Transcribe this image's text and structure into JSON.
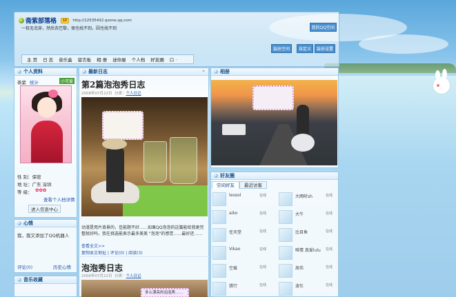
{
  "header": {
    "title": "斋紫部落格",
    "vip": "LV",
    "url": "http://12535432.qzone.qq.com",
    "motto": "一枝无北穿，然后去巴黎，保也找不到，因也找不到",
    "manage_button": "我的QQ空间",
    "nav": [
      "主 页",
      "日 志",
      "音乐盒",
      "留言板",
      "相 册",
      "迷你屋",
      "个人档",
      "好友圈",
      "口 ·"
    ],
    "top_buttons": [
      "装扮空间",
      "自定义",
      "装扮设置"
    ]
  },
  "profile": {
    "title": "个人资料",
    "name_label": "斋紫",
    "stats": "统计",
    "more": "小可爱",
    "gender_row": "性 别：保密",
    "location_row": "地 址：广东 深圳",
    "level_row": "等 级：",
    "view_profile": "查看个人档详情",
    "enter_center": "进入信息中心"
  },
  "mood": {
    "title": "心情",
    "text": "我，我又添加了QQ机器人",
    "comment": "评论(0)",
    "history": "历史心情"
  },
  "music": {
    "title": "音乐收藏"
  },
  "blog": {
    "title": "最新日志",
    "post1_title": "第2篇泡泡秀日志",
    "post1_meta_date": "2008年07月22日",
    "post1_meta_cat": "分类：",
    "post1_meta_link": "个人日记",
    "post1_body": "动漫是用片背景的，佳能题不好……如果QQ泡泡的这篇能给我更完整就好吗，我在挑选能表示最多美美 \"泡泡\"的感觉……最好还……",
    "post1_more": "查看全文>>",
    "post1_footer": "复制本文地址 | 评论(0) | 阅读(3)",
    "post2_title": "泡泡秀日志",
    "post2_meta_date": "2008年07月22日",
    "post2_meta_cat": "分类：",
    "post2_meta_link": "个人日记",
    "photo_bubble_text": "多么漂亮的泡泡秀……"
  },
  "album": {
    "title": "相册"
  },
  "friends": {
    "title": "好友圈",
    "tabs": [
      "空间好友",
      "最近访客"
    ],
    "list": [
      {
        "name": "leosol",
        "status": "在线"
      },
      {
        "name": "大雨听sh",
        "status": "在线"
      },
      {
        "name": "aiko",
        "status": "在线"
      },
      {
        "name": "大牛",
        "status": "在线"
      },
      {
        "name": "任天堂",
        "status": "在线"
      },
      {
        "name": "比目鱼",
        "status": "在线"
      },
      {
        "name": "Vikao",
        "status": "在线"
      },
      {
        "name": "唯情 真爱lulu",
        "status": "在线"
      },
      {
        "name": "空痕",
        "status": "在线"
      },
      {
        "name": "周伟",
        "status": "在线"
      },
      {
        "name": "猎行",
        "status": "在线"
      },
      {
        "name": "波仕",
        "status": "在线"
      }
    ]
  },
  "colors": {
    "accent": "#134c86",
    "button": "#4a8fcf",
    "green": "#49a03b"
  }
}
